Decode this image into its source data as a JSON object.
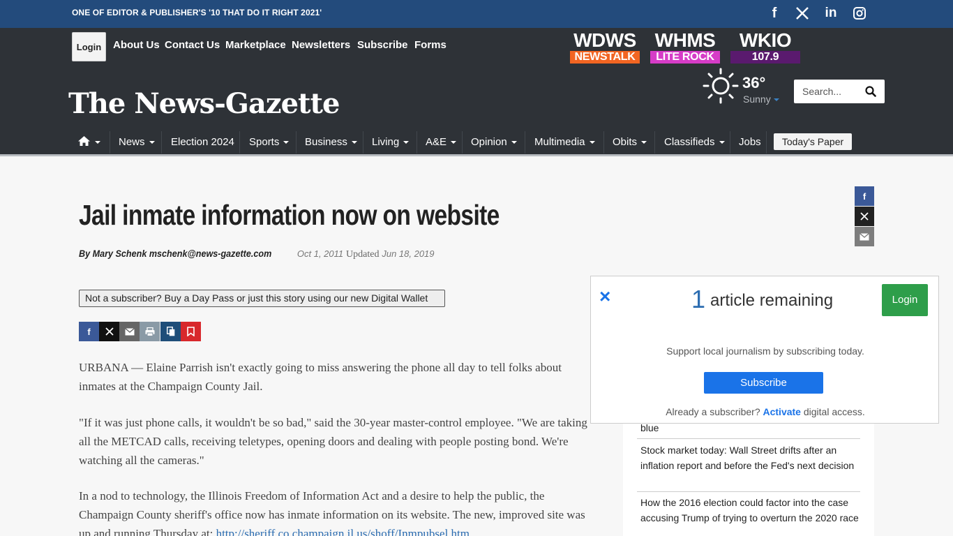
{
  "topbar": {
    "tagline": "ONE OF EDITOR & PUBLISHER'S '10 THAT DO IT RIGHT 2021'",
    "social": [
      {
        "icon": "facebook-icon",
        "glyph": "f"
      },
      {
        "icon": "x-twitter-icon",
        "glyph": "X"
      },
      {
        "icon": "linkedin-icon",
        "glyph": "in"
      },
      {
        "icon": "instagram-icon",
        "glyph": ""
      }
    ]
  },
  "header": {
    "login_label": "Login",
    "links": [
      "About Us",
      "Contact Us",
      "Marketplace",
      "Newsletters",
      "Subscribe",
      "Forms"
    ],
    "stations": [
      {
        "call": "WDWS",
        "sub": "NEWSTALK",
        "color": "#f26522"
      },
      {
        "call": "WHMS",
        "sub": "LITE ROCK",
        "color": "#d63cc7"
      },
      {
        "call": "WKIO",
        "sub": "107.9",
        "color": "#5a1a6e"
      }
    ],
    "masthead": "The News-Gazette",
    "weather": {
      "temp": "36°",
      "condition": "Sunny"
    },
    "search_placeholder": "Search..."
  },
  "nav": {
    "home_icon": "home-icon",
    "items": [
      "News",
      "Election 2024",
      "Sports",
      "Business",
      "Living",
      "A&E",
      "Opinion",
      "Multimedia",
      "Obits",
      "Classifieds",
      "Jobs"
    ],
    "todays_paper": "Today's Paper"
  },
  "article": {
    "headline": "Jail inmate information now on website",
    "author": "By Mary Schenk mschenk@news-gazette.com",
    "date": "Oct 1, 2011",
    "updated_label": "Updated",
    "updated_date": "Jun 18, 2019",
    "daypass": "Not a subscriber? Buy a Day Pass or just this story using our new Digital Wallet",
    "p1": "URBANA — Elaine Parrish isn't exactly going to miss answering the phone all day to tell folks about inmates at the Champaign County Jail.",
    "p2": "\"If it was just phone calls, it wouldn't be so bad,\" said the 30-year master-control employee. \"We are taking all the METCAD calls, receiving teletypes, opening doors and dealing with people posting bond. We're watching all the cameras.\"",
    "p3a": "In a nod to technology, the Illinois Freedom of Information Act and a desire to help the public, the Champaign County sheriff's office now has inmate information on its website. The new, improved site was up and running Thursday at: ",
    "p3_link": "http://sheriff.co.champaign.il.us/shoff/Inmpubsel.htm"
  },
  "sidebar": {
    "items": [
      "blue",
      "Stock market today: Wall Street drifts after an inflation report and before the Fed's next decision",
      "How the 2016 election could factor into the case accusing Trump of trying to overturn the 2020 race"
    ]
  },
  "modal": {
    "count": "1",
    "remaining": "article remaining",
    "login": "Login",
    "support": "Support local journalism by subscribing today.",
    "subscribe": "Subscribe",
    "already": "Already a subscriber?",
    "activate": "Activate",
    "digital": "digital access."
  }
}
